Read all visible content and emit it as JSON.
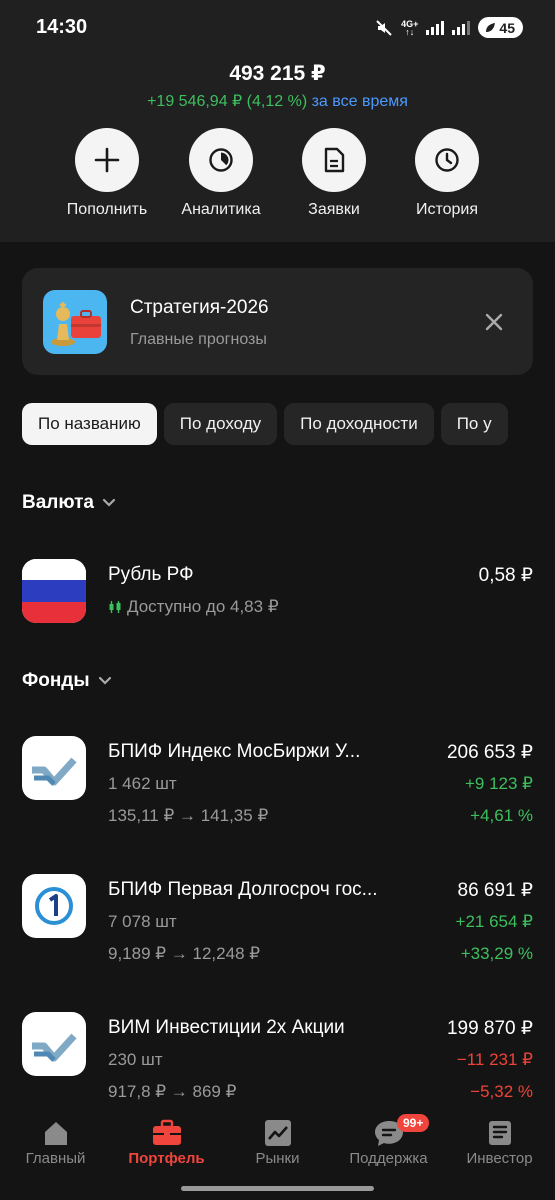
{
  "status_bar": {
    "time": "14:30",
    "network": "4G+",
    "battery": "45"
  },
  "portfolio": {
    "total": "493 215 ₽",
    "change": "+19 546,94 ₽ (4,12 %)",
    "period": "за все время"
  },
  "actions": [
    {
      "label": "Пополнить",
      "icon": "plus-icon"
    },
    {
      "label": "Аналитика",
      "icon": "pie-chart-icon"
    },
    {
      "label": "Заявки",
      "icon": "document-icon"
    },
    {
      "label": "История",
      "icon": "clock-icon"
    }
  ],
  "banner": {
    "title": "Стратегия-2026",
    "subtitle": "Главные прогнозы"
  },
  "sort_chips": [
    "По названию",
    "По доходу",
    "По доходности",
    "По у"
  ],
  "sections": {
    "currency": "Валюта",
    "funds": "Фонды"
  },
  "currency_items": [
    {
      "name": "Рубль РФ",
      "available": "Доступно до 4,83 ₽",
      "value": "0,58 ₽"
    }
  ],
  "fund_items": [
    {
      "name": "БПИФ Индекс МосБиржи У...",
      "qty": "1 462 шт",
      "price": "135,11 ₽ → 141,35 ₽",
      "value": "206 653 ₽",
      "profit": "+9 123 ₽",
      "pct": "+4,61 %",
      "trend": "up"
    },
    {
      "name": "БПИФ Первая Долгосроч гос...",
      "qty": "7 078 шт",
      "price": "9,189 ₽ → 12,248 ₽",
      "value": "86 691 ₽",
      "profit": "+21 654 ₽",
      "pct": "+33,29 %",
      "trend": "up"
    },
    {
      "name": "ВИМ Инвестиции 2х Акции",
      "qty": "230 шт",
      "price": "917,8 ₽ → 869 ₽",
      "value": "199 870 ₽",
      "profit": "−11 231 ₽",
      "pct": "−5,32 %",
      "trend": "down"
    }
  ],
  "tabbar": {
    "items": [
      {
        "label": "Главный",
        "icon": "home-icon"
      },
      {
        "label": "Портфель",
        "icon": "briefcase-icon",
        "active": true
      },
      {
        "label": "Рынки",
        "icon": "chart-icon"
      },
      {
        "label": "Поддержка",
        "icon": "chat-icon",
        "badge": "99+"
      },
      {
        "label": "Инвестор",
        "icon": "newspaper-icon"
      }
    ]
  },
  "colors": {
    "accent": "#f0453d",
    "positive": "#3dbf5e",
    "negative": "#ee4438",
    "link": "#4c9aff",
    "background": "#141414"
  }
}
